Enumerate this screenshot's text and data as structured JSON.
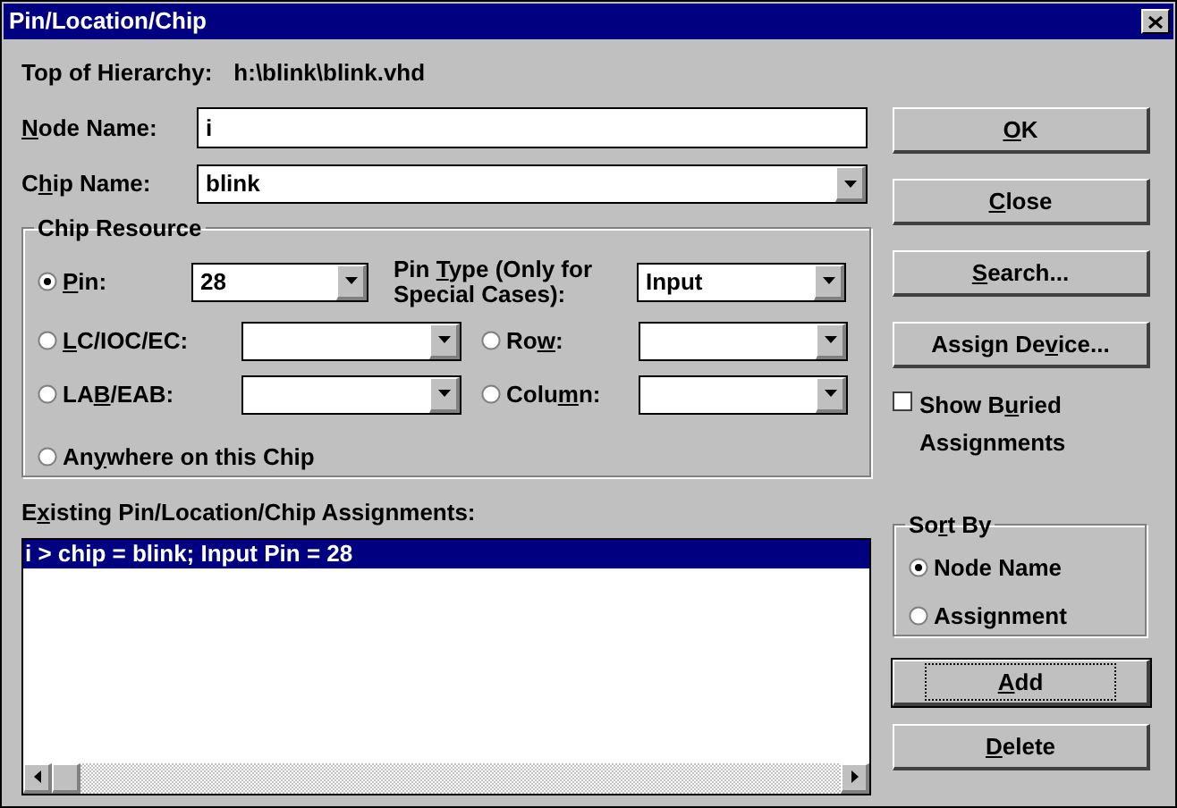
{
  "window": {
    "title": "Pin/Location/Chip"
  },
  "hierarchy": {
    "label": "Top of Hierarchy:",
    "value": "h:\\blink\\blink.vhd"
  },
  "node_name": {
    "label": {
      "key": "N",
      "post": "ode Name:"
    },
    "value": "i"
  },
  "chip_name": {
    "label": {
      "pre": "C",
      "key": "h",
      "post": "ip Name:"
    },
    "value": "blink"
  },
  "chip_resource": {
    "title": "Chip Resource",
    "options": [
      {
        "label": {
          "key": "P",
          "post": "in:"
        },
        "selected": true,
        "field": {
          "value": "28"
        }
      },
      {
        "label": {
          "key": "L",
          "post": "C/IOC/EC:"
        },
        "selected": false
      },
      {
        "label": {
          "pre": "Ro",
          "key": "w",
          "post": ":"
        },
        "selected": false
      },
      {
        "label": {
          "pre": "LA",
          "key": "B",
          "post": "/EAB:"
        },
        "selected": false
      },
      {
        "label": {
          "pre": "Colu",
          "key": "m",
          "post": "n:"
        },
        "selected": false
      },
      {
        "label": {
          "pre": "An",
          "key": "y",
          "post": "where on this Chip"
        },
        "selected": false
      }
    ],
    "pin_type": {
      "label": {
        "pre": "Pin ",
        "key": "T",
        "post": "ype (Only for Special Cases):"
      },
      "value": "Input"
    }
  },
  "assignments": {
    "label": {
      "pre": "E",
      "key": "x",
      "post": "isting Pin/Location/Chip Assignments:"
    },
    "rows": [
      {
        "text": "i > chip = blink; Input Pin = 28",
        "selected": true
      }
    ]
  },
  "buttons": [
    {
      "label": {
        "key": "O",
        "post": "K"
      }
    },
    {
      "label": {
        "key": "C",
        "post": "lose"
      }
    },
    {
      "label": {
        "key": "S",
        "post": "earch..."
      }
    },
    {
      "label": {
        "pre": "Assign De",
        "key": "v",
        "post": "ice..."
      }
    }
  ],
  "show_buried": {
    "label": {
      "pre": "Show B",
      "key": "u",
      "post": "ried Assignments"
    },
    "checked": false
  },
  "sort_by": {
    "title": {
      "pre": "So",
      "key": "r",
      "post": "t By"
    },
    "options": [
      {
        "label": "Node Name",
        "selected": true
      },
      {
        "label": "Assignment",
        "selected": false
      }
    ]
  },
  "actions": [
    {
      "label": {
        "key": "A",
        "post": "dd"
      },
      "default": true
    },
    {
      "label": {
        "key": "D",
        "post": "elete"
      },
      "default": false
    }
  ]
}
